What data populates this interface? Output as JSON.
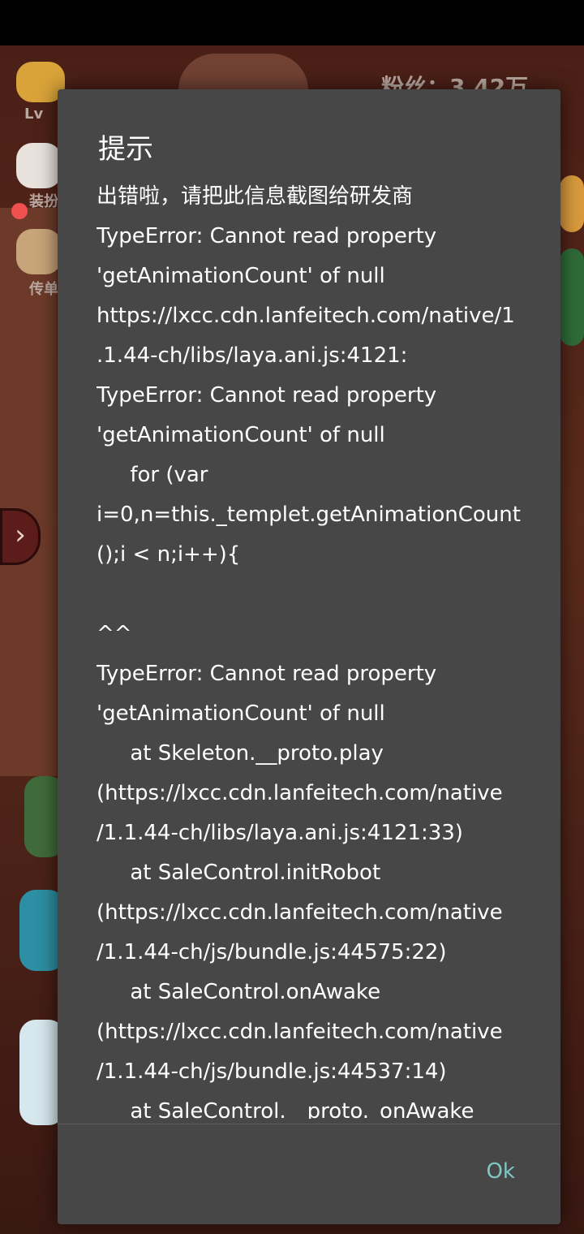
{
  "dialog": {
    "title": "提示",
    "message_lines": [
      "出错啦，请把此信息截图给研发商",
      "TypeError: Cannot read property",
      "'getAnimationCount' of null",
      "https://lxcc.cdn.lanfeitech.com/native/1",
      ".1.44-ch/libs/laya.ani.js:4121:",
      "TypeError: Cannot read property",
      "'getAnimationCount' of null",
      "     for (var",
      "i=0,n=this._templet.getAnimationCount",
      "();i < n;i++){",
      "",
      "^^",
      "TypeError: Cannot read property",
      "'getAnimationCount' of null",
      "     at Skeleton.__proto.play",
      "(https://lxcc.cdn.lanfeitech.com/native",
      "/1.1.44-ch/libs/laya.ani.js:4121:33)",
      "     at SaleControl.initRobot",
      "(https://lxcc.cdn.lanfeitech.com/native",
      "/1.1.44-ch/js/bundle.js:44575:22)",
      "     at SaleControl.onAwake",
      "(https://lxcc.cdn.lanfeitech.com/native",
      "/1.1.44-ch/js/bundle.js:44537:14)",
      "     at SaleControl.__proto._onAwake"
    ],
    "ok_label": "Ok"
  },
  "background_game": {
    "level_label": "Lv",
    "fans_label": "粉丝：3.42万",
    "left_button_1": "装扮",
    "left_button_2": "传单"
  },
  "colors": {
    "dialog_bg": "#474747",
    "ok_text": "#7fc7c4"
  }
}
